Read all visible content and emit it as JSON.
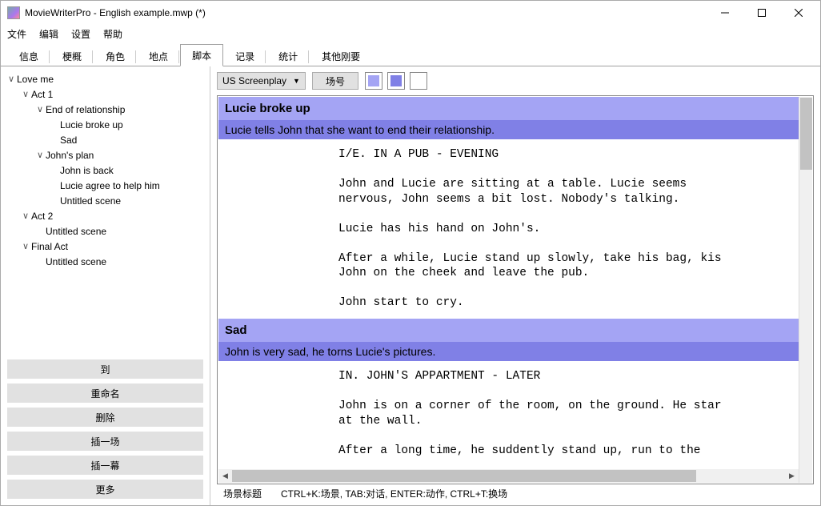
{
  "window": {
    "title": "MovieWriterPro - English example.mwp (*)"
  },
  "menu": {
    "file": "文件",
    "edit": "编辑",
    "settings": "设置",
    "help": "帮助"
  },
  "tabs": {
    "info": "信息",
    "outline": "梗概",
    "roles": "角色",
    "places": "地点",
    "script": "脚本",
    "records": "记录",
    "stats": "统计",
    "other": "其他刚要"
  },
  "tree": {
    "root": "Love me",
    "act1": "Act 1",
    "end_rel": "End of relationship",
    "lucie_broke": "Lucie broke up",
    "sad": "Sad",
    "johns_plan": "John's plan",
    "john_back": "John is back",
    "lucie_agree": "Lucie agree to help him",
    "untitled1": "Untitled scene",
    "act2": "Act 2",
    "untitled2": "Untitled scene",
    "final_act": "Final Act",
    "untitled3": "Untitled scene"
  },
  "left_buttons": {
    "to": "到",
    "rename": "重命名",
    "delete": "删除",
    "insert_scene": "插一场",
    "insert_act": "插一幕",
    "more": "更多"
  },
  "toolbar": {
    "format": "US Screenplay",
    "scene_num": "场号"
  },
  "colors": {
    "light": "#a4a4f4",
    "mid": "#8080e6",
    "white": "#ffffff"
  },
  "editor": {
    "scene1_title": "Lucie broke up",
    "scene1_desc": "Lucie tells John that she want to end their relationship.",
    "scene1_body": "I/E. IN A PUB - EVENING\n\nJohn and Lucie are sitting at a table. Lucie seems\nnervous, John seems a bit lost. Nobody's talking.\n\nLucie has his hand on John's.\n\nAfter a while, Lucie stand up slowly, take his bag, kis\nJohn on the cheek and leave the pub.\n\nJohn start to cry.",
    "scene2_title": "Sad",
    "scene2_desc": "John is very sad, he torns Lucie's pictures.",
    "scene2_body": "IN. JOHN'S APPARTMENT - LATER\n\nJohn is on a corner of the room, on the ground. He star\nat the wall.\n\nAfter a long time, he suddently stand up, run to the"
  },
  "status": {
    "left": "场景标题",
    "hints": "CTRL+K:场景, TAB:对话, ENTER:动作, CTRL+T:换场"
  }
}
